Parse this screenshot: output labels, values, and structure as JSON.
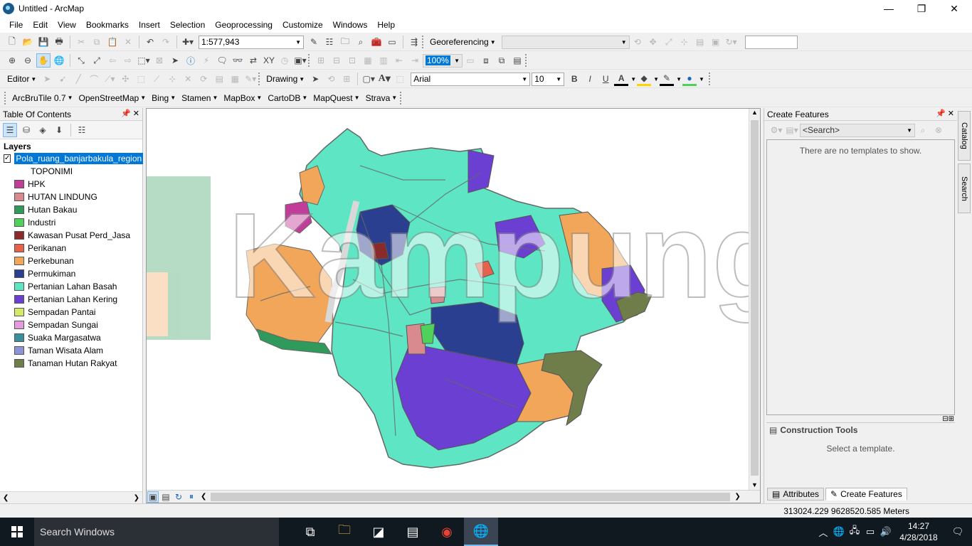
{
  "window": {
    "title": "Untitled - ArcMap",
    "minimize": "—",
    "maximize": "❐",
    "close": "✕"
  },
  "menu": [
    "File",
    "Edit",
    "View",
    "Bookmarks",
    "Insert",
    "Selection",
    "Geoprocessing",
    "Customize",
    "Windows",
    "Help"
  ],
  "toolbar1": {
    "scale": "1:577,943",
    "georef_label": "Georeferencing"
  },
  "toolbar2": {
    "zoom_field": "100%"
  },
  "toolbar3": {
    "editor_label": "Editor",
    "drawing_label": "Drawing",
    "font_name": "Arial",
    "font_size": "10",
    "bold": "B",
    "italic": "I",
    "underline": "U",
    "text_tool": "A"
  },
  "toolbar4": {
    "items": [
      "ArcBruTile 0.7",
      "OpenStreetMap",
      "Bing",
      "Stamen",
      "MapBox",
      "CartoDB",
      "MapQuest",
      "Strava"
    ]
  },
  "toc": {
    "title": "Table Of Contents",
    "layers_label": "Layers",
    "layer_name": "Pola_ruang_banjarbakula_region",
    "field_name": "TOPONIMI",
    "legend": [
      {
        "label": "HPK",
        "color": "#c23d9a"
      },
      {
        "label": "HUTAN LINDUNG",
        "color": "#d98a8f"
      },
      {
        "label": "Hutan Bakau",
        "color": "#2f9a5b"
      },
      {
        "label": "Industri",
        "color": "#4fd15a"
      },
      {
        "label": "Kawasan Pusat Perd_Jasa",
        "color": "#8b2a2a"
      },
      {
        "label": "Perikanan",
        "color": "#e8614a"
      },
      {
        "label": "Perkebunan",
        "color": "#f2a65a"
      },
      {
        "label": "Permukiman",
        "color": "#2a3f8f"
      },
      {
        "label": "Pertanian Lahan Basah",
        "color": "#5ee6c4"
      },
      {
        "label": "Pertanian Lahan Kering",
        "color": "#6b3fd1"
      },
      {
        "label": "Sempadan Pantai",
        "color": "#d6e86a"
      },
      {
        "label": "Sempadan Sungai",
        "color": "#e59ae0"
      },
      {
        "label": "Suaka Margasatwa",
        "color": "#3a8f9a"
      },
      {
        "label": "Taman Wisata Alam",
        "color": "#8a94d6"
      },
      {
        "label": "Tanaman Hutan Rakyat",
        "color": "#6e7d4a"
      }
    ]
  },
  "create_features": {
    "title": "Create Features",
    "search_placeholder": "<Search>",
    "no_templates": "There are no templates to show.",
    "construction_tools": "Construction Tools",
    "select_template": "Select a template.",
    "tab_attributes": "Attributes",
    "tab_create": "Create Features"
  },
  "side_tabs": [
    "Catalog",
    "Search"
  ],
  "status": {
    "coordinates": "313024.229  9628520.585 Meters"
  },
  "taskbar": {
    "search_text": "Search Windows",
    "time": "14:27",
    "date": "4/28/2018"
  },
  "watermark": "KampungTechno"
}
